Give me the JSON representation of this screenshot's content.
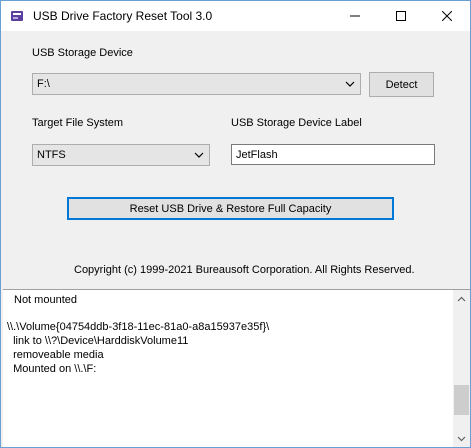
{
  "window": {
    "title": "USB Drive Factory Reset Tool 3.0"
  },
  "colors": {
    "accent": "#0078d7",
    "titlebar_bg": "#ffffff",
    "window_bg": "#f0f0f0",
    "app_icon": "#5b3fa0"
  },
  "device": {
    "label": "USB Storage Device",
    "selected": "F:\\",
    "detect_label": "Detect"
  },
  "filesystem": {
    "label": "Target File System",
    "selected": "NTFS"
  },
  "volume_label": {
    "label": "USB Storage Device Label",
    "value": "JetFlash"
  },
  "actions": {
    "reset_label": "Reset USB Drive & Restore Full Capacity"
  },
  "copyright": "Copyright (c) 1999-2021 Bureausoft Corporation. All Rights Reserved.",
  "log": {
    "lines": [
      "Not mounted",
      "",
      "\\\\.\\Volume{04754ddb-3f18-11ec-81a0-a8a15937e35f}\\",
      "  link to \\\\?\\Device\\HarddiskVolume11",
      "  removeable media",
      "  Mounted on \\\\.\\F:"
    ]
  }
}
